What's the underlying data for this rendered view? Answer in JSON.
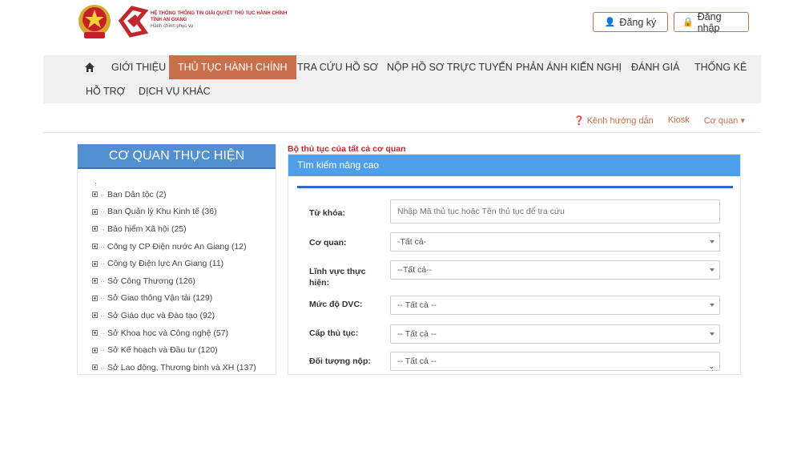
{
  "header": {
    "logo": {
      "line1": "HỆ THỐNG THÔNG TIN GIẢI QUYẾT THỦ TỤC HÀNH CHÍNH",
      "line2": "TỈNH AN GIANG",
      "line3": "Hành chính phục vụ"
    },
    "register_label": "Đăng ký",
    "login_label": "Đăng nhập"
  },
  "nav": {
    "items": [
      {
        "label": "GIỚI THIỆU"
      },
      {
        "label": "THỦ TỤC HÀNH CHÍNH"
      },
      {
        "label": "TRA CỨU HỒ SƠ"
      },
      {
        "label": "NỘP HỒ SƠ TRỰC TUYẾN"
      },
      {
        "label": "PHẢN ÁNH KIẾN NGHỊ"
      },
      {
        "label": "ĐÁNH GIÁ"
      },
      {
        "label": "THỐNG KÊ"
      },
      {
        "label": "HỖ TRỢ"
      },
      {
        "label": "DỊCH VỤ KHÁC"
      }
    ]
  },
  "sublinks": {
    "guide": "Kênh hướng dẫn",
    "kiosk": "Kiosk",
    "agency": "Cơ quan"
  },
  "sidebar": {
    "title": "CƠ QUAN THỰC HIỆN",
    "items": [
      {
        "label": "Ban Dân tộc (2)"
      },
      {
        "label": "Ban Quản lý Khu Kinh tế (36)"
      },
      {
        "label": "Bảo hiểm Xã hội (25)"
      },
      {
        "label": "Công ty CP Điện nước An Giang (12)"
      },
      {
        "label": "Công ty Điện lực An Giang (11)"
      },
      {
        "label": "Sở Công Thương (126)"
      },
      {
        "label": "Sở Giao thông Vận tải (129)"
      },
      {
        "label": "Sở Giáo dục và Đào tạo (92)"
      },
      {
        "label": "Sở Khoa học và Công nghệ (57)"
      },
      {
        "label": "Sở Kế hoạch và Đầu tư (120)"
      },
      {
        "label": "Sở Lao động, Thương binh và XH (137)"
      }
    ]
  },
  "main": {
    "section_title": "Bộ thủ tục của tất cả cơ quan",
    "panel_title": "Tìm kiếm nâng cao",
    "form": {
      "keyword_label": "Từ khóa:",
      "keyword_placeholder": "Nhập Mã thủ tục hoặc Tên thủ tục để tra cứu",
      "agency_label": "Cơ quan:",
      "agency_value": "-Tất cả-",
      "field_label": "Lĩnh vực thực hiện:",
      "field_value": "--Tất cả--",
      "level_label": "Mức độ DVC:",
      "level_value": "-- Tất cả --",
      "tier_label": "Cấp thủ tục:",
      "tier_value": "-- Tất cả --",
      "target_label": "Đối tượng nộp:",
      "target_value": "-- Tất cả --"
    }
  },
  "colors": {
    "accent": "#c8704b",
    "blue_header": "#4f8fd2",
    "panel_blue": "#4f9eea",
    "title_red": "#c0282d"
  }
}
